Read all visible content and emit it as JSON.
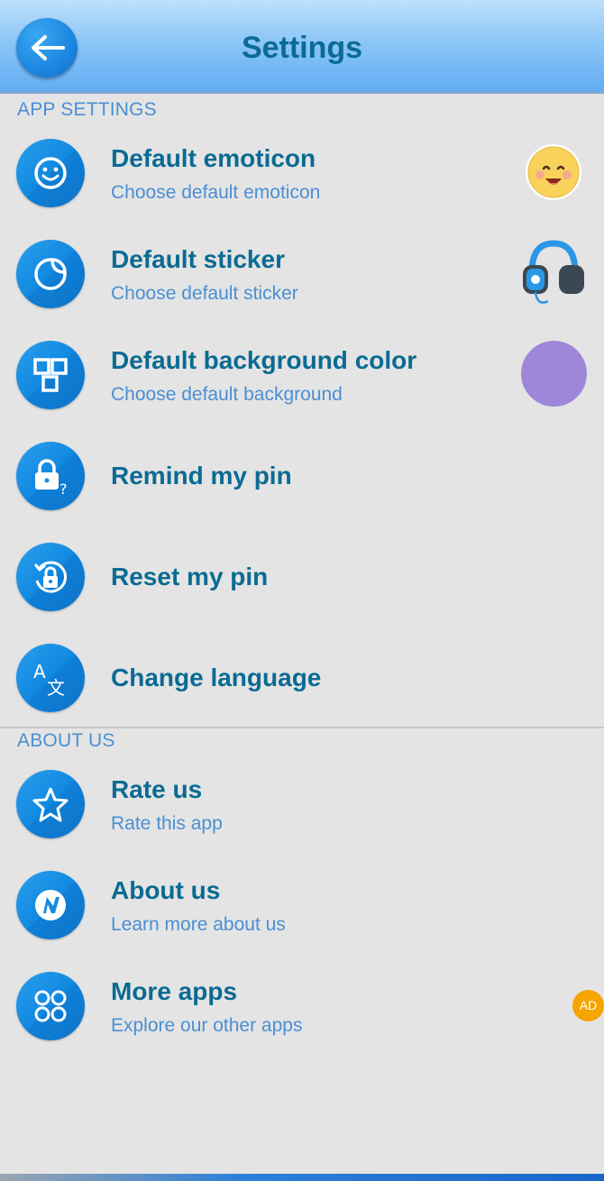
{
  "header": {
    "title": "Settings",
    "back_icon": "arrow-left-icon"
  },
  "sections": {
    "app": {
      "label": "APP SETTINGS"
    },
    "about": {
      "label": "ABOUT US"
    }
  },
  "items": [
    {
      "title": "Default emoticon",
      "subtitle": "Choose default emoticon",
      "icon": "smiley-icon"
    },
    {
      "title": "Default sticker",
      "subtitle": "Choose default sticker",
      "icon": "sticker-icon"
    },
    {
      "title": "Default background color",
      "subtitle": "Choose default background",
      "icon": "background-icon",
      "color": "#9e86d8"
    },
    {
      "title": "Remind my pin",
      "icon": "lock-question-icon"
    },
    {
      "title": "Reset my pin",
      "icon": "lock-reset-icon"
    },
    {
      "title": "Change language",
      "icon": "translate-icon"
    },
    {
      "title": "Rate us",
      "subtitle": "Rate this app",
      "icon": "star-icon"
    },
    {
      "title": "About us",
      "subtitle": "Learn more about us",
      "icon": "info-logo-icon"
    },
    {
      "title": "More apps",
      "subtitle": "Explore our other apps",
      "icon": "grid-icon"
    }
  ],
  "ad_badge": "AD",
  "colors": {
    "accent": "#1a8ae3",
    "title": "#0a6b93",
    "subtitle": "#4a8fd4",
    "background": "#e4e4e4"
  }
}
